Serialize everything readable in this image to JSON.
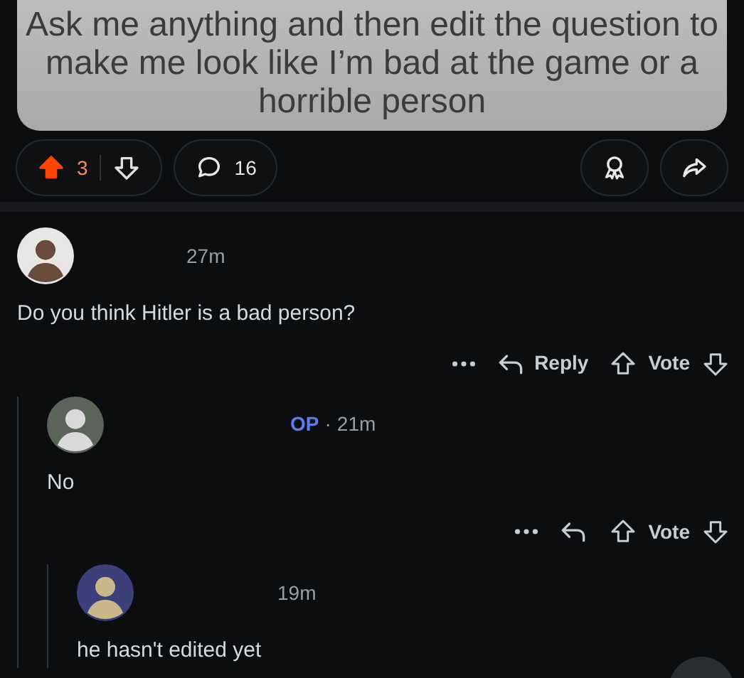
{
  "post": {
    "text": "Ask me anything and then edit the question to make me look like I’m bad at the game or a horrible person",
    "upvoted": true,
    "score": "3",
    "comments": "16"
  },
  "comments": [
    {
      "time": "27m",
      "body": "Do you think Hitler is a bad person?",
      "actions": {
        "reply": "Reply",
        "vote": "Vote"
      },
      "children": [
        {
          "badge": "OP",
          "separator": "·",
          "time": "21m",
          "body": "No",
          "actions": {
            "vote": "Vote"
          },
          "children": [
            {
              "time": "19m",
              "body": "he hasn't edited yet"
            }
          ]
        }
      ]
    }
  ]
}
